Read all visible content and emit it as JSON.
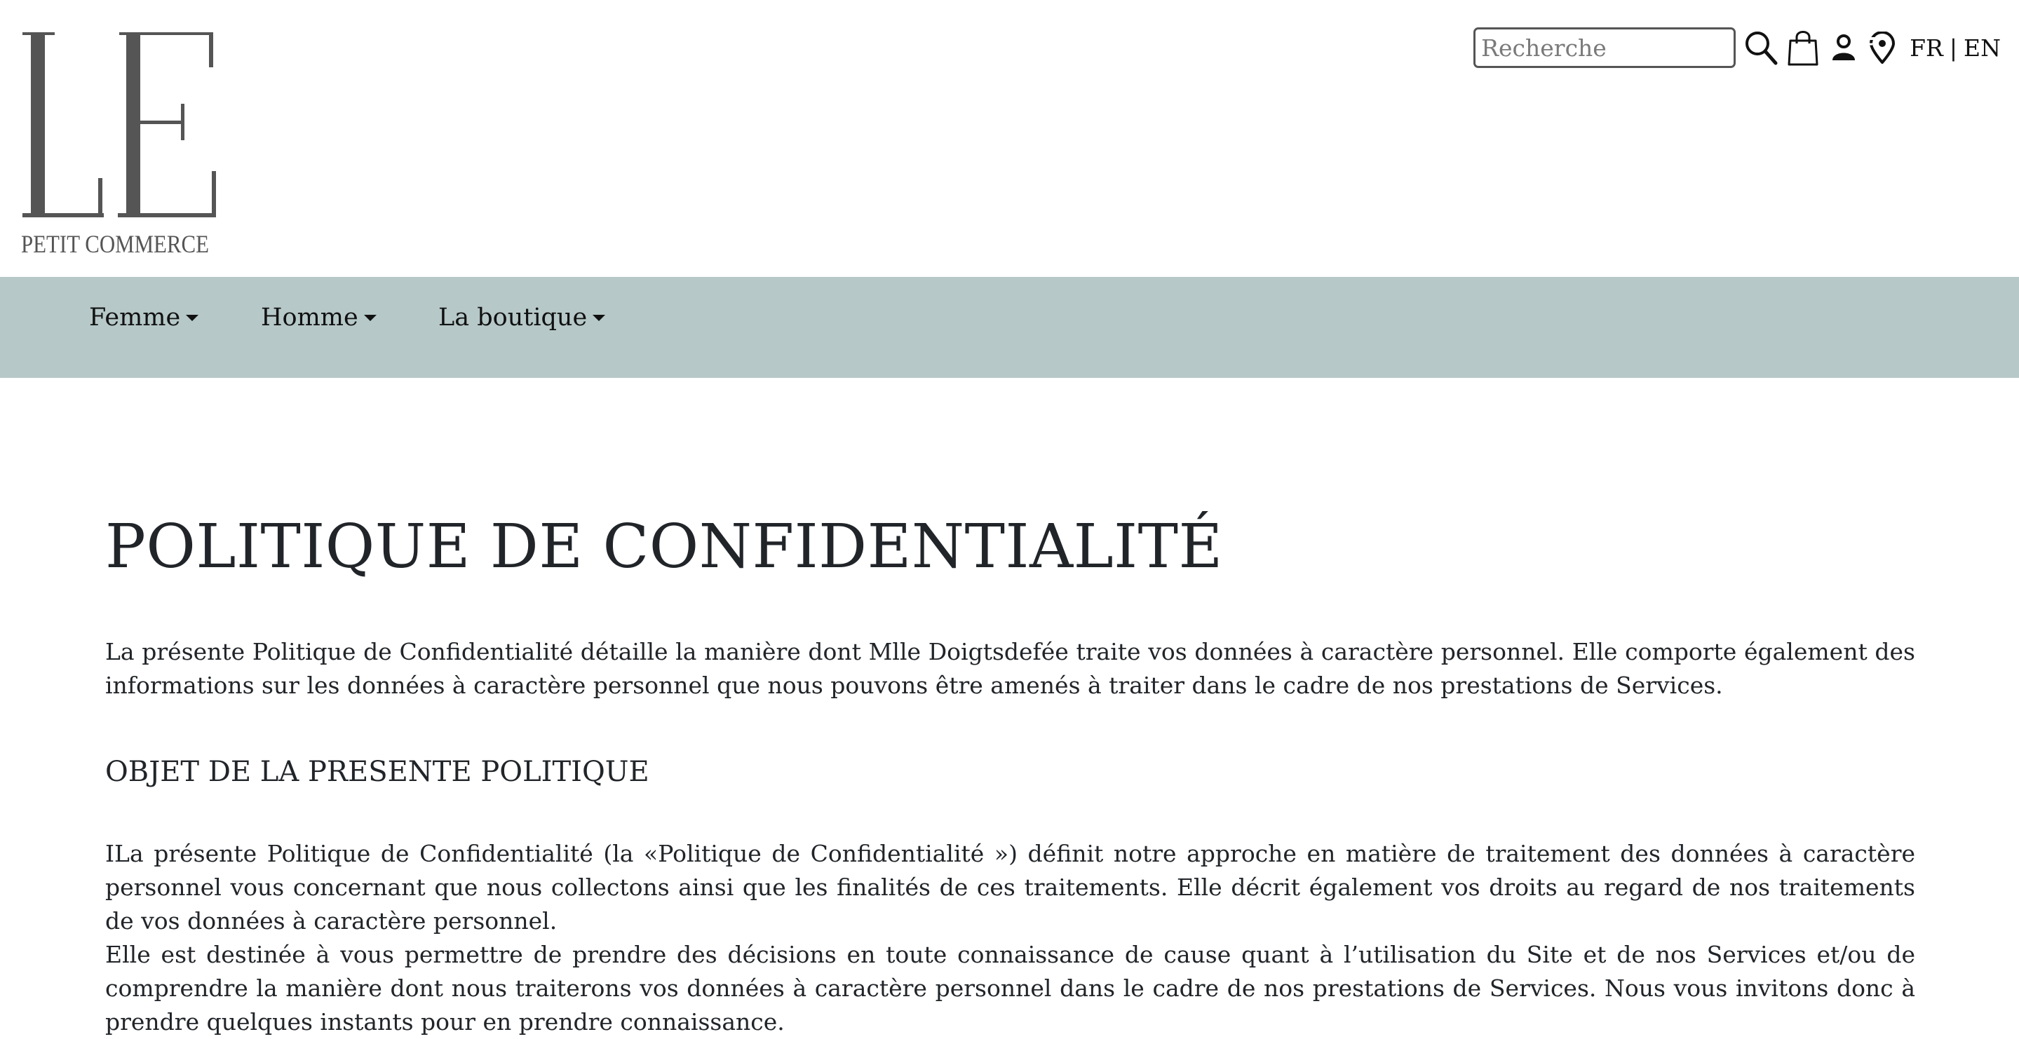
{
  "logo": {
    "letters": "LE",
    "tagline": "PETIT COMMERCE"
  },
  "header": {
    "search": {
      "placeholder": "Recherche",
      "value": ""
    },
    "icons": [
      "search-icon",
      "shopping-bag-icon",
      "user-icon",
      "location-pin-icon"
    ],
    "languages": [
      "FR",
      "EN"
    ],
    "language_separator": "|"
  },
  "nav": {
    "background": "#b6c8c8",
    "items": [
      {
        "label": "Femme"
      },
      {
        "label": "Homme"
      },
      {
        "label": "La boutique"
      }
    ]
  },
  "main": {
    "title": "POLITIQUE DE CONFIDENTIALITÉ",
    "intro": "La présente Politique de Confidentialité détaille la manière dont Mlle Doigtsdefée traite vos données à caractère personnel. Elle comporte également des informations sur les données à caractère personnel que nous pouvons être amenés à traiter dans le cadre de nos prestations de Services.",
    "section_heading": "OBJET DE LA PRESENTE POLITIQUE",
    "paragraphs": [
      "ILa présente Politique de Confidentialité (la «Politique de Confidentialité ») définit notre approche en matière de traitement des données à caractère personnel vous concernant que nous collectons ainsi que les finalités de ces traitements. Elle décrit également vos droits au regard de nos traitements de vos données à caractère personnel.",
      "Elle est destinée à vous permettre de prendre des décisions en toute connaissance de cause quant à l’utilisation du Site et de nos Services et/ou de comprendre la manière dont nous traiterons vos données à caractère personnel dans le cadre de nos prestations de Services. Nous vous invitons donc à prendre quelques instants pour en prendre connaissance."
    ]
  }
}
